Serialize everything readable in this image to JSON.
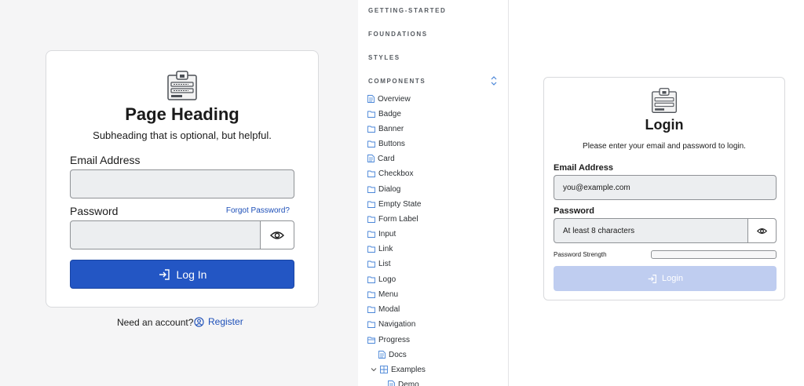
{
  "left": {
    "heading": "Page Heading",
    "subheading": "Subheading that is optional, but helpful.",
    "email_label": "Email Address",
    "password_label": "Password",
    "forgot": "Forgot Password?",
    "login_button": "Log In",
    "need_account": "Need an account?",
    "register": "Register"
  },
  "nav": {
    "sections": [
      "GETTING-STARTED",
      "FOUNDATIONS",
      "STYLES",
      "COMPONENTS"
    ],
    "items": [
      {
        "label": "Overview",
        "icon": "document-icon"
      },
      {
        "label": "Badge",
        "icon": "folder-icon"
      },
      {
        "label": "Banner",
        "icon": "folder-icon"
      },
      {
        "label": "Buttons",
        "icon": "folder-icon"
      },
      {
        "label": "Card",
        "icon": "document-icon"
      },
      {
        "label": "Checkbox",
        "icon": "folder-icon"
      },
      {
        "label": "Dialog",
        "icon": "folder-icon"
      },
      {
        "label": "Empty State",
        "icon": "folder-icon"
      },
      {
        "label": "Form Label",
        "icon": "folder-icon"
      },
      {
        "label": "Input",
        "icon": "folder-icon"
      },
      {
        "label": "Link",
        "icon": "folder-icon"
      },
      {
        "label": "List",
        "icon": "folder-icon"
      },
      {
        "label": "Logo",
        "icon": "folder-icon"
      },
      {
        "label": "Menu",
        "icon": "folder-icon"
      },
      {
        "label": "Modal",
        "icon": "folder-icon"
      },
      {
        "label": "Navigation",
        "icon": "folder-icon"
      },
      {
        "label": "Progress",
        "icon": "folder-open-icon"
      },
      {
        "label": "Docs",
        "icon": "document-icon"
      },
      {
        "label": "Examples",
        "icon": "grid-icon"
      },
      {
        "label": "Demo",
        "icon": "document-icon"
      }
    ]
  },
  "right": {
    "title": "Login",
    "subtitle": "Please enter your email and password to login.",
    "email_label": "Email Address",
    "email_value": "you@example.com",
    "password_label": "Password",
    "password_placeholder": "At least 8 characters",
    "strength_label": "Password Strength",
    "login_button": "Login"
  }
}
